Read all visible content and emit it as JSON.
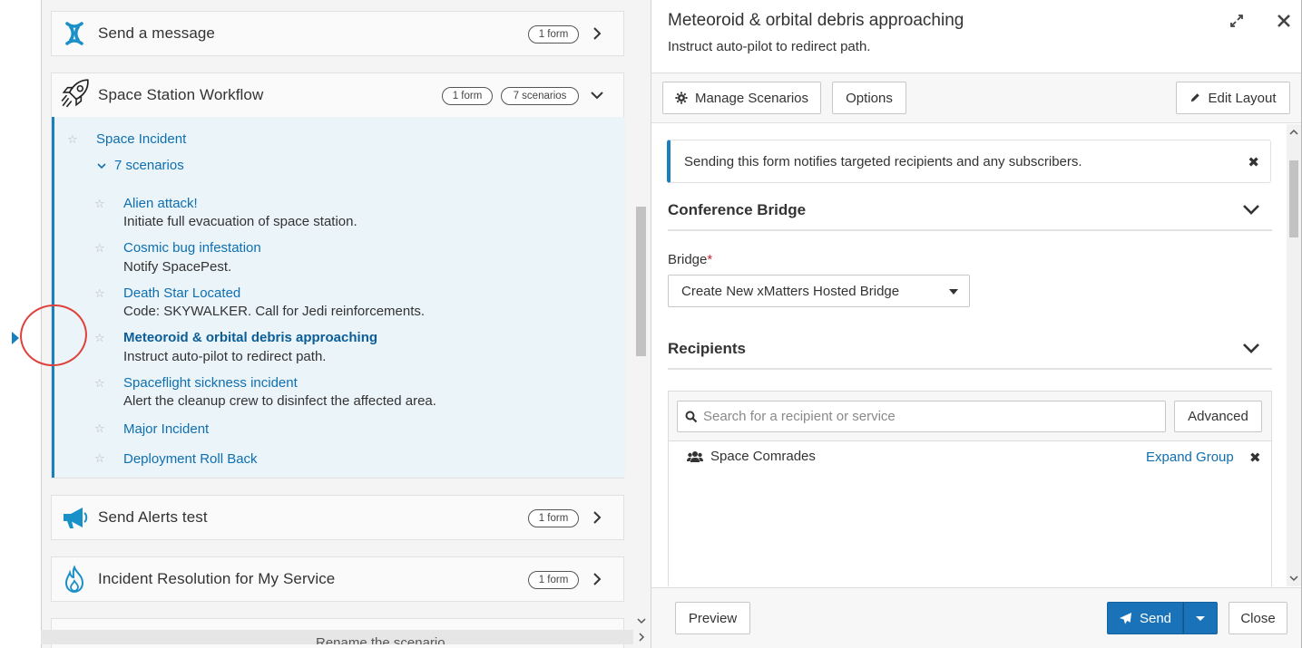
{
  "left": {
    "workflows": [
      {
        "title": "Send a message",
        "form_pill": "1 form"
      },
      {
        "title": "Space Station Workflow",
        "form_pill": "1 form",
        "scenario_pill": "7 scenarios"
      },
      {
        "title": "Send Alerts test",
        "form_pill": "1 form"
      },
      {
        "title": "Incident Resolution for My Service",
        "form_pill": "1 form"
      }
    ],
    "expanded": {
      "form_title": "Space Incident",
      "scenarios_toggle": "7 scenarios",
      "scenarios": [
        {
          "title": "Alien attack!",
          "desc": "Initiate full evacuation of space station."
        },
        {
          "title": "Cosmic bug infestation",
          "desc": "Notify SpacePest."
        },
        {
          "title": "Death Star Located",
          "desc": "Code: SKYWALKER. Call for Jedi reinforcements."
        },
        {
          "title": "Meteoroid & orbital debris approaching",
          "desc": "Instruct auto-pilot to redirect path.",
          "selected": true
        },
        {
          "title": "Spaceflight sickness incident",
          "desc": "Alert the cleanup crew to disinfect the affected area."
        },
        {
          "title": "Major Incident",
          "desc": ""
        },
        {
          "title": "Deployment Roll Back",
          "desc": ""
        }
      ]
    },
    "partial_text": "Rename the scenario"
  },
  "dialog": {
    "title": "Meteoroid & orbital debris approaching",
    "subtitle": "Instruct auto-pilot to redirect path.",
    "toolbar": {
      "manage_scenarios": "Manage Scenarios",
      "options": "Options",
      "edit_layout": "Edit Layout"
    },
    "notice": "Sending this form notifies targeted recipients and any subscribers.",
    "conference_bridge": {
      "heading": "Conference Bridge",
      "bridge_label": "Bridge",
      "required_mark": "*",
      "bridge_value": "Create New xMatters Hosted Bridge"
    },
    "recipients": {
      "heading": "Recipients",
      "search_placeholder": "Search for a recipient or service",
      "advanced": "Advanced",
      "items": [
        {
          "name": "Space Comrades",
          "action": "Expand Group"
        }
      ]
    },
    "footer": {
      "preview": "Preview",
      "send": "Send",
      "close": "Close"
    }
  },
  "colors": {
    "accent": "#1a80bd",
    "link": "#0f6fb0",
    "send": "#1a73b8",
    "annotation": "#e0403a",
    "expanded_bg": "#eaf4f9"
  },
  "icons": {
    "send_a_message": "xmatters-logo-icon",
    "space_station_workflow": "rocket-icon",
    "send_alerts_test": "megaphone-icon",
    "incident_resolution": "flame-icon"
  }
}
